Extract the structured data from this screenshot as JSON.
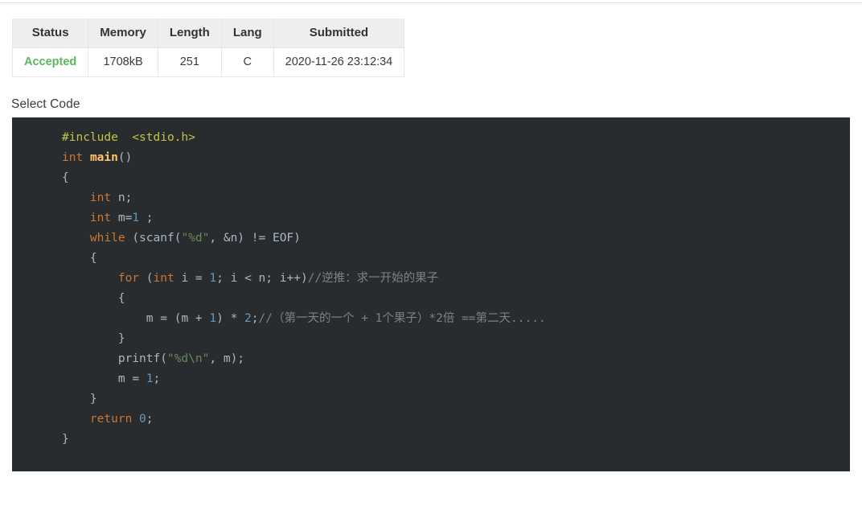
{
  "page": {
    "select_code_label": "Select Code"
  },
  "result_table": {
    "headers": [
      "Status",
      "Memory",
      "Length",
      "Lang",
      "Submitted"
    ],
    "row": {
      "status": "Accepted",
      "memory": "1708kB",
      "length": "251",
      "lang": "C",
      "submitted": "2020-11-26 23:12:34"
    },
    "colors": {
      "accepted": "#5cb85c",
      "header_bg": "#eeeeee",
      "border": "#e6e6e6"
    }
  },
  "code": {
    "language": "C",
    "background": "#282c2f",
    "default_text_color": "#a9b7c6",
    "syntax_colors": {
      "keyword": "#cc7832",
      "function": "#ffc66d",
      "preprocessor": "#c5c53f",
      "string": "#6a8759",
      "number": "#6897bb",
      "comment": "#808080"
    },
    "lines": [
      "    #include  <stdio.h>",
      "    int main()",
      "    {",
      "        int n;",
      "        int m=1 ;",
      "        while (scanf(\"%d\", &n) != EOF)",
      "        {",
      "            for (int i = 1; i < n; i++)//逆推：求一开始的果子",
      "            {",
      "                m = (m + 1) * 2;//（第一天的一个 + 1个果子）*2倍 ==第二天.....",
      "            }",
      "            printf(\"%d\\n\", m);",
      "            m = 1;",
      "        }",
      "        return 0;",
      "    }"
    ]
  }
}
